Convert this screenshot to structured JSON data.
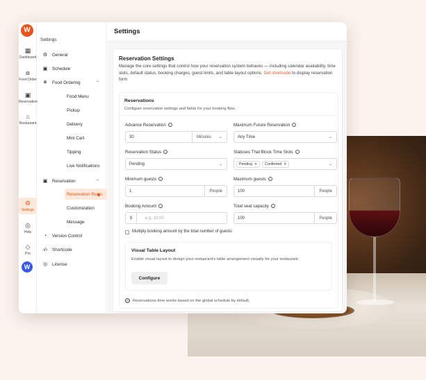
{
  "app": {
    "logo_letter": "W",
    "rail": [
      {
        "label": "Dashboard",
        "icon": "grid-icon",
        "glyph": "▦"
      },
      {
        "label": "Food Order",
        "icon": "food-icon",
        "glyph": "⧇"
      },
      {
        "label": "Reservation",
        "icon": "calendar-icon",
        "glyph": "▣"
      },
      {
        "label": "Restaurant",
        "icon": "store-icon",
        "glyph": "⌂"
      },
      {
        "label": "Settings",
        "icon": "gear-icon",
        "glyph": "⚙"
      },
      {
        "label": "Help",
        "icon": "help-icon",
        "glyph": "◎"
      },
      {
        "label": "Pro",
        "icon": "diamond-icon",
        "glyph": "◇"
      }
    ],
    "wp_letter": "W"
  },
  "sidebar": {
    "heading": "Settings",
    "items": [
      {
        "label": "General",
        "glyph": "⚙"
      },
      {
        "label": "Schedule",
        "glyph": "▣"
      },
      {
        "label": "Food Ordering",
        "glyph": "⧇"
      },
      {
        "label": "Food Menu"
      },
      {
        "label": "Pickup"
      },
      {
        "label": "Delivery"
      },
      {
        "label": "Mini Cart"
      },
      {
        "label": "Tipping"
      },
      {
        "label": "Live Notifications"
      },
      {
        "label": "Reservation",
        "glyph": "▣"
      },
      {
        "label": "Reservation Rules"
      },
      {
        "label": "Customization"
      },
      {
        "label": "Message"
      },
      {
        "label": "Version Control",
        "glyph": "◔"
      },
      {
        "label": "Shortcode",
        "glyph": "‹/›"
      },
      {
        "label": "License",
        "glyph": "◎"
      }
    ]
  },
  "header": {
    "title": "Settings"
  },
  "panel": {
    "title": "Reservation Settings",
    "desc": "Manage the core settings that control how your reservation system behaves — including calendar availability, time slots, default status, booking charges, guest limits, and table layout options. ",
    "link": "Get shortcode",
    "desc_tail": " to display reservation form"
  },
  "reservations": {
    "title": "Reservations",
    "desc": "Configure reservation settings and fields for your booking flow.",
    "advance_label": "Advance Reservation",
    "advance_value": "30",
    "advance_unit": "Minutes",
    "max_future_label": "Maximum Future Reservation",
    "max_future_value": "Any Time",
    "status_label": "Reservation Status",
    "status_value": "Pending",
    "block_label": "Statuses That Block Time Slots",
    "block_tags": [
      "Pending",
      "Confirmed"
    ],
    "min_guests_label": "Minimum guests",
    "min_guests_value": "1",
    "people": "People",
    "max_guests_label": "Maximum guests",
    "max_guests_value": "100",
    "booking_label": "Booking Amount",
    "currency": "$",
    "booking_placeholder": "e.g. 10.00",
    "capacity_label": "Total seat capacity",
    "capacity_value": "100",
    "multiply_label": "Multiply booking amount by the total number of guests",
    "visual_title": "Visual Table Layout",
    "visual_desc": "Enable visual layout to design your restaurant's table arrangement visually for your restaurant.",
    "configure": "Configure",
    "note": "Reservations time works based on the global schedule by default."
  },
  "colors": {
    "accent": "#e8541a",
    "wp": "#3858e9"
  }
}
